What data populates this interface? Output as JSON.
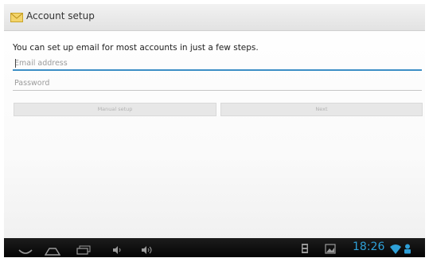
{
  "titlebar": {
    "title": "Account setup",
    "icon": "email-envelope-icon"
  },
  "form": {
    "instructions": "You can set up email for most accounts in just a few steps.",
    "email": {
      "value": "",
      "placeholder": "Email address"
    },
    "password": {
      "value": "",
      "placeholder": "Password"
    }
  },
  "buttons": {
    "manual_setup": "Manual setup",
    "next": "Next"
  },
  "system_bar": {
    "clock": "18:26",
    "icons": [
      "back-icon",
      "home-icon",
      "recent-apps-icon",
      "volume-down-icon",
      "volume-up-icon",
      "sd-card-icon",
      "screenshot-icon",
      "wifi-icon",
      "usb-debug-icon"
    ]
  },
  "colors": {
    "accent": "#3d8fc6",
    "clock": "#2ea0d8",
    "navbar": "#0a0a0a"
  }
}
